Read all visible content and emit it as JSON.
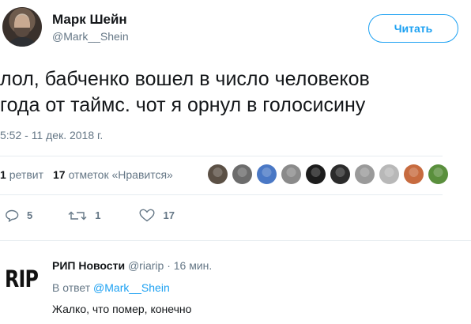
{
  "tweet": {
    "author_name": "Марк Шейн",
    "author_handle": "@Mark__Shein",
    "follow_label": "Читать",
    "text_line1": "лол, бабченко вошел в число человеков",
    "text_line2": "года от таймс. чот я орнул в голосисину",
    "timestamp": "5:52 - 11 дек. 2018 г."
  },
  "stats": {
    "retweet_count": "1",
    "retweet_label": "ретвит",
    "like_count": "17",
    "like_label": "отметок «Нравится»"
  },
  "likers": [
    {
      "icon": "liker-avatar",
      "color": "#5b5045"
    },
    {
      "icon": "liker-avatar",
      "color": "#6c6c6c"
    },
    {
      "icon": "liker-avatar",
      "color": "#4a78c5"
    },
    {
      "icon": "liker-avatar",
      "color": "#8a8a8a"
    },
    {
      "icon": "liker-avatar",
      "color": "#1c1c1c"
    },
    {
      "icon": "liker-avatar",
      "color": "#2b2b2b"
    },
    {
      "icon": "liker-avatar",
      "color": "#9a9a9a"
    },
    {
      "icon": "liker-avatar",
      "color": "#b8b8b8"
    },
    {
      "icon": "liker-avatar",
      "color": "#c76b3f"
    },
    {
      "icon": "liker-avatar",
      "color": "#5a8f3d"
    }
  ],
  "actions": {
    "reply_count": "5",
    "retweet_count": "1",
    "like_count": "17"
  },
  "reply": {
    "logo_text": "RIP",
    "author_name": "РИП Новости",
    "author_handle": "@riarip",
    "separator": "·",
    "time_ago": "16 мин.",
    "reply_prefix": "В ответ",
    "reply_mention": "@Mark__Shein",
    "text": "Жалко, что помер, конечно"
  },
  "colors": {
    "accent": "#1da1f2",
    "muted": "#657786",
    "text": "#14171a",
    "divider": "#e6ecf0"
  }
}
